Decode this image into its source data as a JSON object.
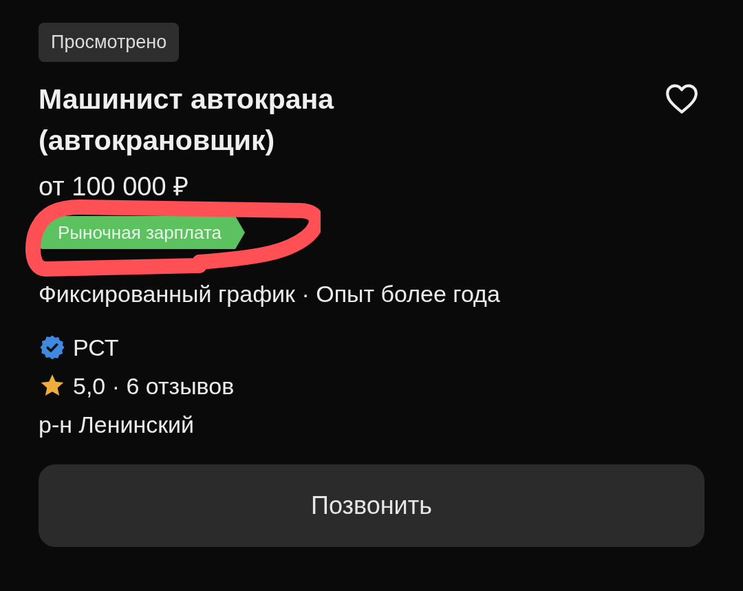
{
  "viewed_tag": "Просмотрено",
  "title": "Машинист автокрана (автокрановщик)",
  "favorite": {
    "selected": false
  },
  "salary": "от 100 000 ₽",
  "salary_badge": "Рыночная зарплата",
  "conditions": "Фиксированный график · Опыт более года",
  "company": {
    "name": "РСТ",
    "verified": true
  },
  "rating": "5,0 · 6 отзывов",
  "district": "р-н Ленинский",
  "call_button": "Позвонить"
}
